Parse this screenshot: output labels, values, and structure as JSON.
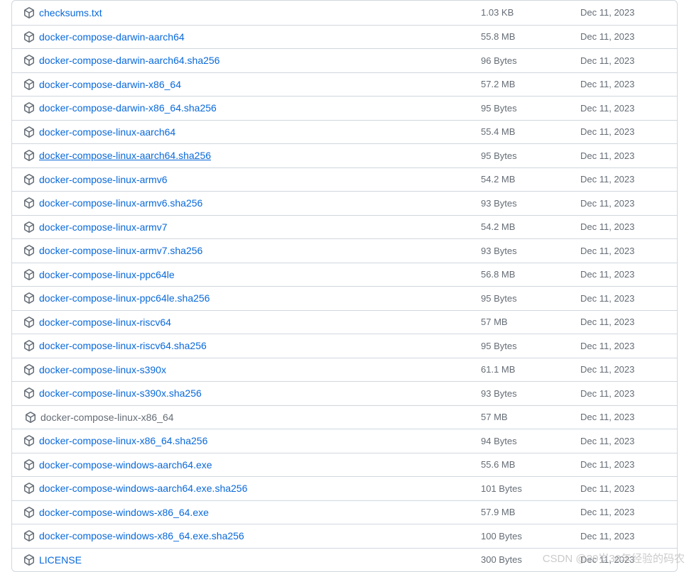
{
  "assets": [
    {
      "name": "checksums.txt",
      "size": "1.03 KB",
      "date": "Dec 11, 2023",
      "highlighted": false,
      "hovered": false,
      "neutralIcon": false
    },
    {
      "name": "docker-compose-darwin-aarch64",
      "size": "55.8 MB",
      "date": "Dec 11, 2023",
      "highlighted": false,
      "hovered": false,
      "neutralIcon": false
    },
    {
      "name": "docker-compose-darwin-aarch64.sha256",
      "size": "96 Bytes",
      "date": "Dec 11, 2023",
      "highlighted": false,
      "hovered": false,
      "neutralIcon": false
    },
    {
      "name": "docker-compose-darwin-x86_64",
      "size": "57.2 MB",
      "date": "Dec 11, 2023",
      "highlighted": false,
      "hovered": false,
      "neutralIcon": false
    },
    {
      "name": "docker-compose-darwin-x86_64.sha256",
      "size": "95 Bytes",
      "date": "Dec 11, 2023",
      "highlighted": false,
      "hovered": false,
      "neutralIcon": false
    },
    {
      "name": "docker-compose-linux-aarch64",
      "size": "55.4 MB",
      "date": "Dec 11, 2023",
      "highlighted": false,
      "hovered": false,
      "neutralIcon": false
    },
    {
      "name": "docker-compose-linux-aarch64.sha256",
      "size": "95 Bytes",
      "date": "Dec 11, 2023",
      "highlighted": false,
      "hovered": true,
      "neutralIcon": false
    },
    {
      "name": "docker-compose-linux-armv6",
      "size": "54.2 MB",
      "date": "Dec 11, 2023",
      "highlighted": false,
      "hovered": false,
      "neutralIcon": false
    },
    {
      "name": "docker-compose-linux-armv6.sha256",
      "size": "93 Bytes",
      "date": "Dec 11, 2023",
      "highlighted": false,
      "hovered": false,
      "neutralIcon": false
    },
    {
      "name": "docker-compose-linux-armv7",
      "size": "54.2 MB",
      "date": "Dec 11, 2023",
      "highlighted": false,
      "hovered": false,
      "neutralIcon": false
    },
    {
      "name": "docker-compose-linux-armv7.sha256",
      "size": "93 Bytes",
      "date": "Dec 11, 2023",
      "highlighted": false,
      "hovered": false,
      "neutralIcon": false
    },
    {
      "name": "docker-compose-linux-ppc64le",
      "size": "56.8 MB",
      "date": "Dec 11, 2023",
      "highlighted": false,
      "hovered": false,
      "neutralIcon": false
    },
    {
      "name": "docker-compose-linux-ppc64le.sha256",
      "size": "95 Bytes",
      "date": "Dec 11, 2023",
      "highlighted": false,
      "hovered": false,
      "neutralIcon": false
    },
    {
      "name": "docker-compose-linux-riscv64",
      "size": "57 MB",
      "date": "Dec 11, 2023",
      "highlighted": false,
      "hovered": false,
      "neutralIcon": false
    },
    {
      "name": "docker-compose-linux-riscv64.sha256",
      "size": "95 Bytes",
      "date": "Dec 11, 2023",
      "highlighted": false,
      "hovered": false,
      "neutralIcon": false
    },
    {
      "name": "docker-compose-linux-s390x",
      "size": "61.1 MB",
      "date": "Dec 11, 2023",
      "highlighted": false,
      "hovered": false,
      "neutralIcon": false
    },
    {
      "name": "docker-compose-linux-s390x.sha256",
      "size": "93 Bytes",
      "date": "Dec 11, 2023",
      "highlighted": false,
      "hovered": false,
      "neutralIcon": false
    },
    {
      "name": "docker-compose-linux-x86_64",
      "size": "57 MB",
      "date": "Dec 11, 2023",
      "highlighted": true,
      "hovered": false,
      "neutralIcon": true
    },
    {
      "name": "docker-compose-linux-x86_64.sha256",
      "size": "94 Bytes",
      "date": "Dec 11, 2023",
      "highlighted": false,
      "hovered": false,
      "neutralIcon": false
    },
    {
      "name": "docker-compose-windows-aarch64.exe",
      "size": "55.6 MB",
      "date": "Dec 11, 2023",
      "highlighted": false,
      "hovered": false,
      "neutralIcon": false
    },
    {
      "name": "docker-compose-windows-aarch64.exe.sha256",
      "size": "101 Bytes",
      "date": "Dec 11, 2023",
      "highlighted": false,
      "hovered": false,
      "neutralIcon": false
    },
    {
      "name": "docker-compose-windows-x86_64.exe",
      "size": "57.9 MB",
      "date": "Dec 11, 2023",
      "highlighted": false,
      "hovered": false,
      "neutralIcon": false
    },
    {
      "name": "docker-compose-windows-x86_64.exe.sha256",
      "size": "100 Bytes",
      "date": "Dec 11, 2023",
      "highlighted": false,
      "hovered": false,
      "neutralIcon": false
    },
    {
      "name": "LICENSE",
      "size": "300 Bytes",
      "date": "Dec 11, 2023",
      "highlighted": false,
      "hovered": false,
      "neutralIcon": false
    }
  ],
  "watermark": "CSDN @20岁30年经验的码农"
}
